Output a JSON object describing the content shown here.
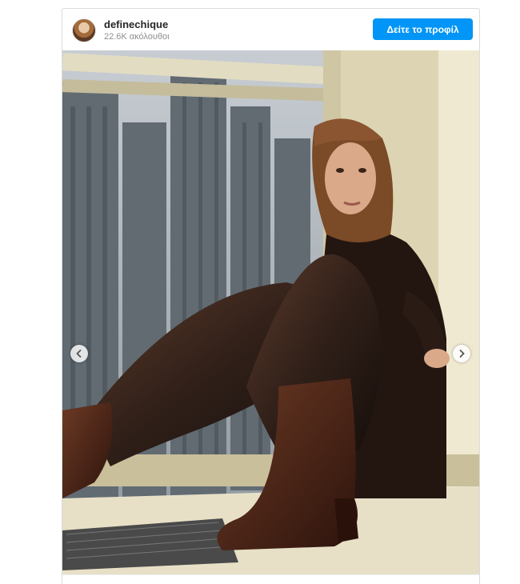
{
  "post": {
    "username": "definechique",
    "followers_text": "22.6K ακόλουθοι",
    "profile_button_label": "Δείτε το προφίλ"
  },
  "media": {
    "alt_content": "photo",
    "icons": [
      "avatar",
      "chevron-left-icon",
      "chevron-right-icon"
    ],
    "colors": {
      "button_blue": "#0095f6",
      "window_frame": "#d9cfa6",
      "leather_brown": "#3b241a"
    }
  }
}
